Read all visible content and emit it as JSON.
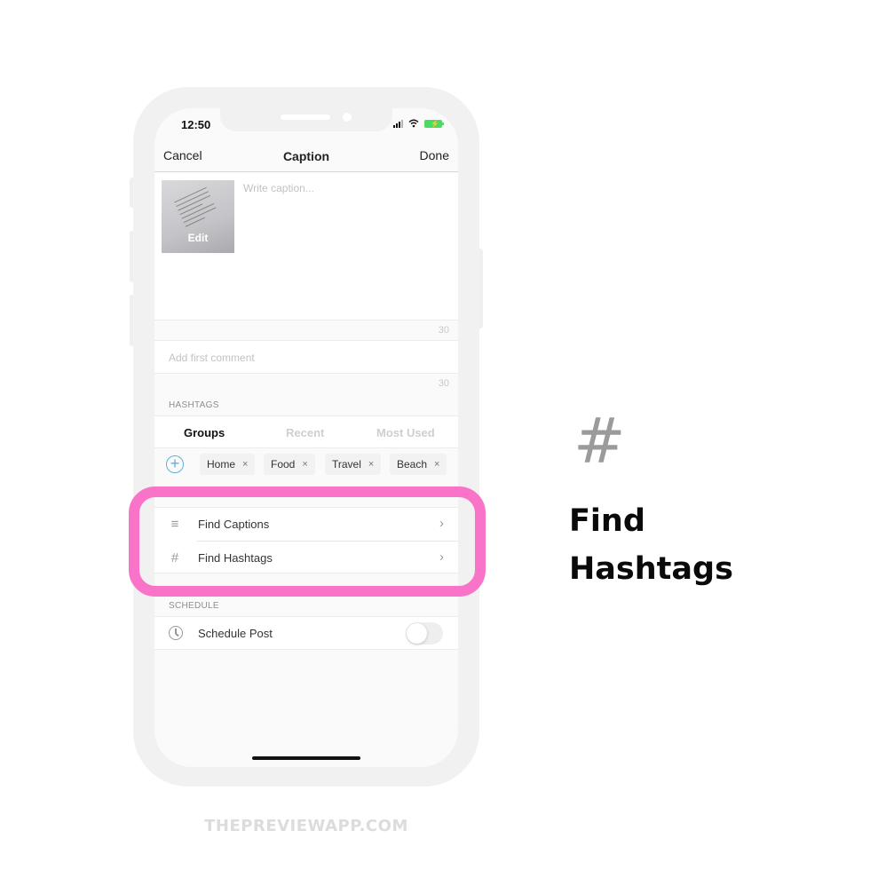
{
  "status_bar": {
    "time": "12:50",
    "icons": [
      "signal-icon",
      "wifi-icon",
      "battery-charging-icon"
    ]
  },
  "nav": {
    "cancel_label": "Cancel",
    "title": "Caption",
    "done_label": "Done"
  },
  "caption": {
    "thumbnail_label": "Edit",
    "placeholder": "Write caption...",
    "char_count": "30"
  },
  "comment": {
    "placeholder": "Add first comment",
    "char_count": "30"
  },
  "hashtags": {
    "section_label": "HASHTAGS",
    "tabs": [
      {
        "label": "Groups",
        "active": true
      },
      {
        "label": "Recent",
        "active": false
      },
      {
        "label": "Most Used",
        "active": false
      }
    ],
    "add_icon": "plus-circle-icon",
    "chips": [
      {
        "label": "Home",
        "remove": "×"
      },
      {
        "label": "Food",
        "remove": "×"
      },
      {
        "label": "Travel",
        "remove": "×"
      },
      {
        "label": "Beach",
        "remove": "×"
      }
    ]
  },
  "menu": {
    "items": [
      {
        "icon": "≡",
        "icon_name": "lines-icon",
        "label": "Find Captions",
        "chevron": "›"
      },
      {
        "icon": "#",
        "icon_name": "hashtag-icon",
        "label": "Find Hashtags",
        "chevron": "›"
      }
    ]
  },
  "schedule": {
    "section_label": "SCHEDULE",
    "label": "Schedule Post",
    "toggle_on": false
  },
  "feature": {
    "icon": "#",
    "title_line1": "Find",
    "title_line2": "Hashtags"
  },
  "footer": {
    "text": "THEPREVIEWAPP.COM"
  },
  "colors": {
    "highlight": "#f973c8",
    "accent": "#5ab3d8",
    "battery": "#4cd964"
  }
}
